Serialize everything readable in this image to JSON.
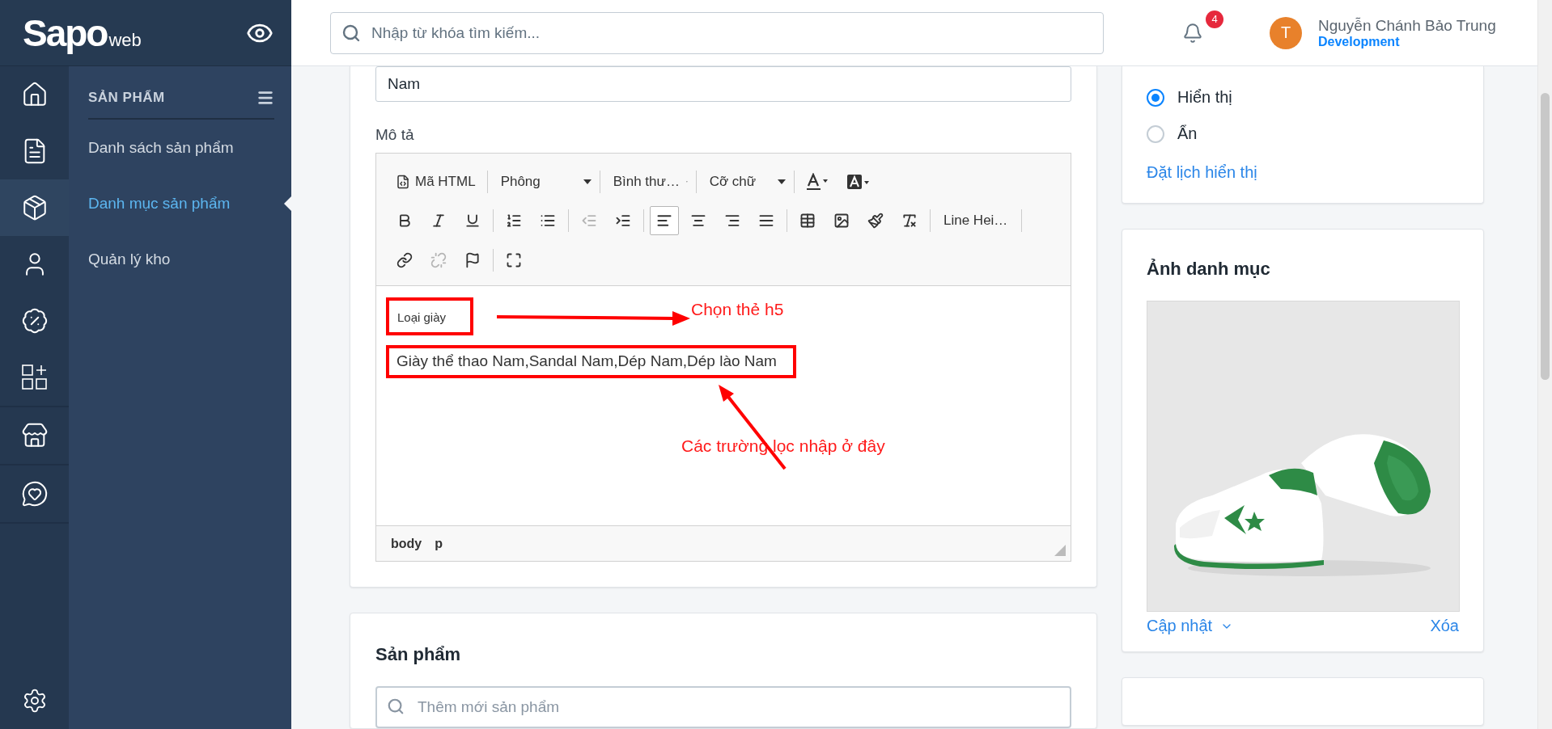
{
  "logo": {
    "name": "Sapo",
    "suffix": "web"
  },
  "rail": {
    "groups": [
      [
        {
          "selected": false
        },
        {
          "selected": false
        },
        {
          "selected": true
        },
        {
          "selected": false
        },
        {
          "selected": false
        },
        {
          "selected": false
        }
      ],
      [
        {
          "selected": false
        }
      ],
      [
        {
          "selected": false
        }
      ]
    ],
    "settings": {
      "selected": false
    }
  },
  "submenu": {
    "title": "SẢN PHẨM",
    "items": [
      {
        "label": "Danh sách sản phẩm",
        "selected": false
      },
      {
        "label": "Danh mục sản phẩm",
        "selected": true
      },
      {
        "label": "Quản lý kho",
        "selected": false
      }
    ]
  },
  "topbar": {
    "search": {
      "placeholder": "Nhập từ khóa tìm kiếm..."
    },
    "notifications": "4",
    "user": {
      "initial": "T",
      "name": "Nguyễn Chánh Bảo Trung",
      "role": "Development"
    }
  },
  "category_form": {
    "name_field": {
      "value": "Nam"
    },
    "description": {
      "label": "Mô tả",
      "toolbar": [
        [
          {
            "kind": "source",
            "label": "Mã HTML"
          },
          {
            "kind": "separator"
          },
          {
            "kind": "dropdown",
            "label": "Phông"
          },
          {
            "kind": "separator"
          },
          {
            "kind": "dropdown",
            "label": "Bình thư…"
          },
          {
            "kind": "separator"
          },
          {
            "kind": "dropdown",
            "label": "Cỡ chữ"
          },
          {
            "kind": "separator"
          },
          {
            "kind": "icon",
            "selected": false,
            "disabled": false
          },
          {
            "kind": "icon",
            "selected": false,
            "disabled": false
          }
        ],
        [
          {
            "kind": "icon",
            "selected": false,
            "disabled": false
          },
          {
            "kind": "icon",
            "selected": false,
            "disabled": false
          },
          {
            "kind": "icon",
            "selected": false,
            "disabled": false
          },
          {
            "kind": "separator"
          },
          {
            "kind": "icon",
            "selected": false,
            "disabled": false
          },
          {
            "kind": "icon",
            "selected": false,
            "disabled": false
          },
          {
            "kind": "separator"
          },
          {
            "kind": "icon",
            "selected": false,
            "disabled": true
          },
          {
            "kind": "icon",
            "selected": false,
            "disabled": false
          },
          {
            "kind": "separator"
          },
          {
            "kind": "icon",
            "selected": true,
            "disabled": false
          },
          {
            "kind": "icon",
            "selected": false,
            "disabled": false
          },
          {
            "kind": "icon",
            "selected": false,
            "disabled": false
          },
          {
            "kind": "icon",
            "selected": false,
            "disabled": false
          },
          {
            "kind": "separator"
          },
          {
            "kind": "icon",
            "selected": false,
            "disabled": false
          },
          {
            "kind": "icon",
            "selected": false,
            "disabled": false
          },
          {
            "kind": "icon",
            "selected": false,
            "disabled": false
          },
          {
            "kind": "icon",
            "selected": false,
            "disabled": false
          },
          {
            "kind": "separator"
          },
          {
            "kind": "dropdown",
            "label": "Line Hei…"
          },
          {
            "kind": "separator"
          }
        ],
        [
          {
            "kind": "icon",
            "selected": false,
            "disabled": false
          },
          {
            "kind": "icon",
            "selected": false,
            "disabled": true
          },
          {
            "kind": "icon",
            "selected": false,
            "disabled": false
          },
          {
            "kind": "separator"
          },
          {
            "kind": "icon",
            "selected": false,
            "disabled": false
          }
        ]
      ],
      "content": [
        {
          "kind": "h5",
          "text": "Loại giày",
          "outlined": true
        },
        {
          "kind": "p",
          "text": "Giày thể thao Nam,Sandal Nam,Dép Nam,Dép lào Nam",
          "outlined": true
        }
      ],
      "annotations": [
        {
          "text": "Chọn thẻ h5"
        },
        {
          "text": "Các trường lọc nhập ở đây"
        }
      ],
      "path": [
        "body",
        "p"
      ]
    }
  },
  "products": {
    "title": "Sản phẩm",
    "search": {
      "placeholder": "Thêm mới sản phẩm"
    }
  },
  "visibility": {
    "options": [
      {
        "label": "Hiển thị",
        "selected": true
      },
      {
        "label": "Ẩn",
        "selected": false
      }
    ],
    "schedule_link": "Đặt lịch hiển thị"
  },
  "image_card": {
    "title": "Ảnh danh mục",
    "update": "Cập nhật",
    "delete": "Xóa"
  }
}
